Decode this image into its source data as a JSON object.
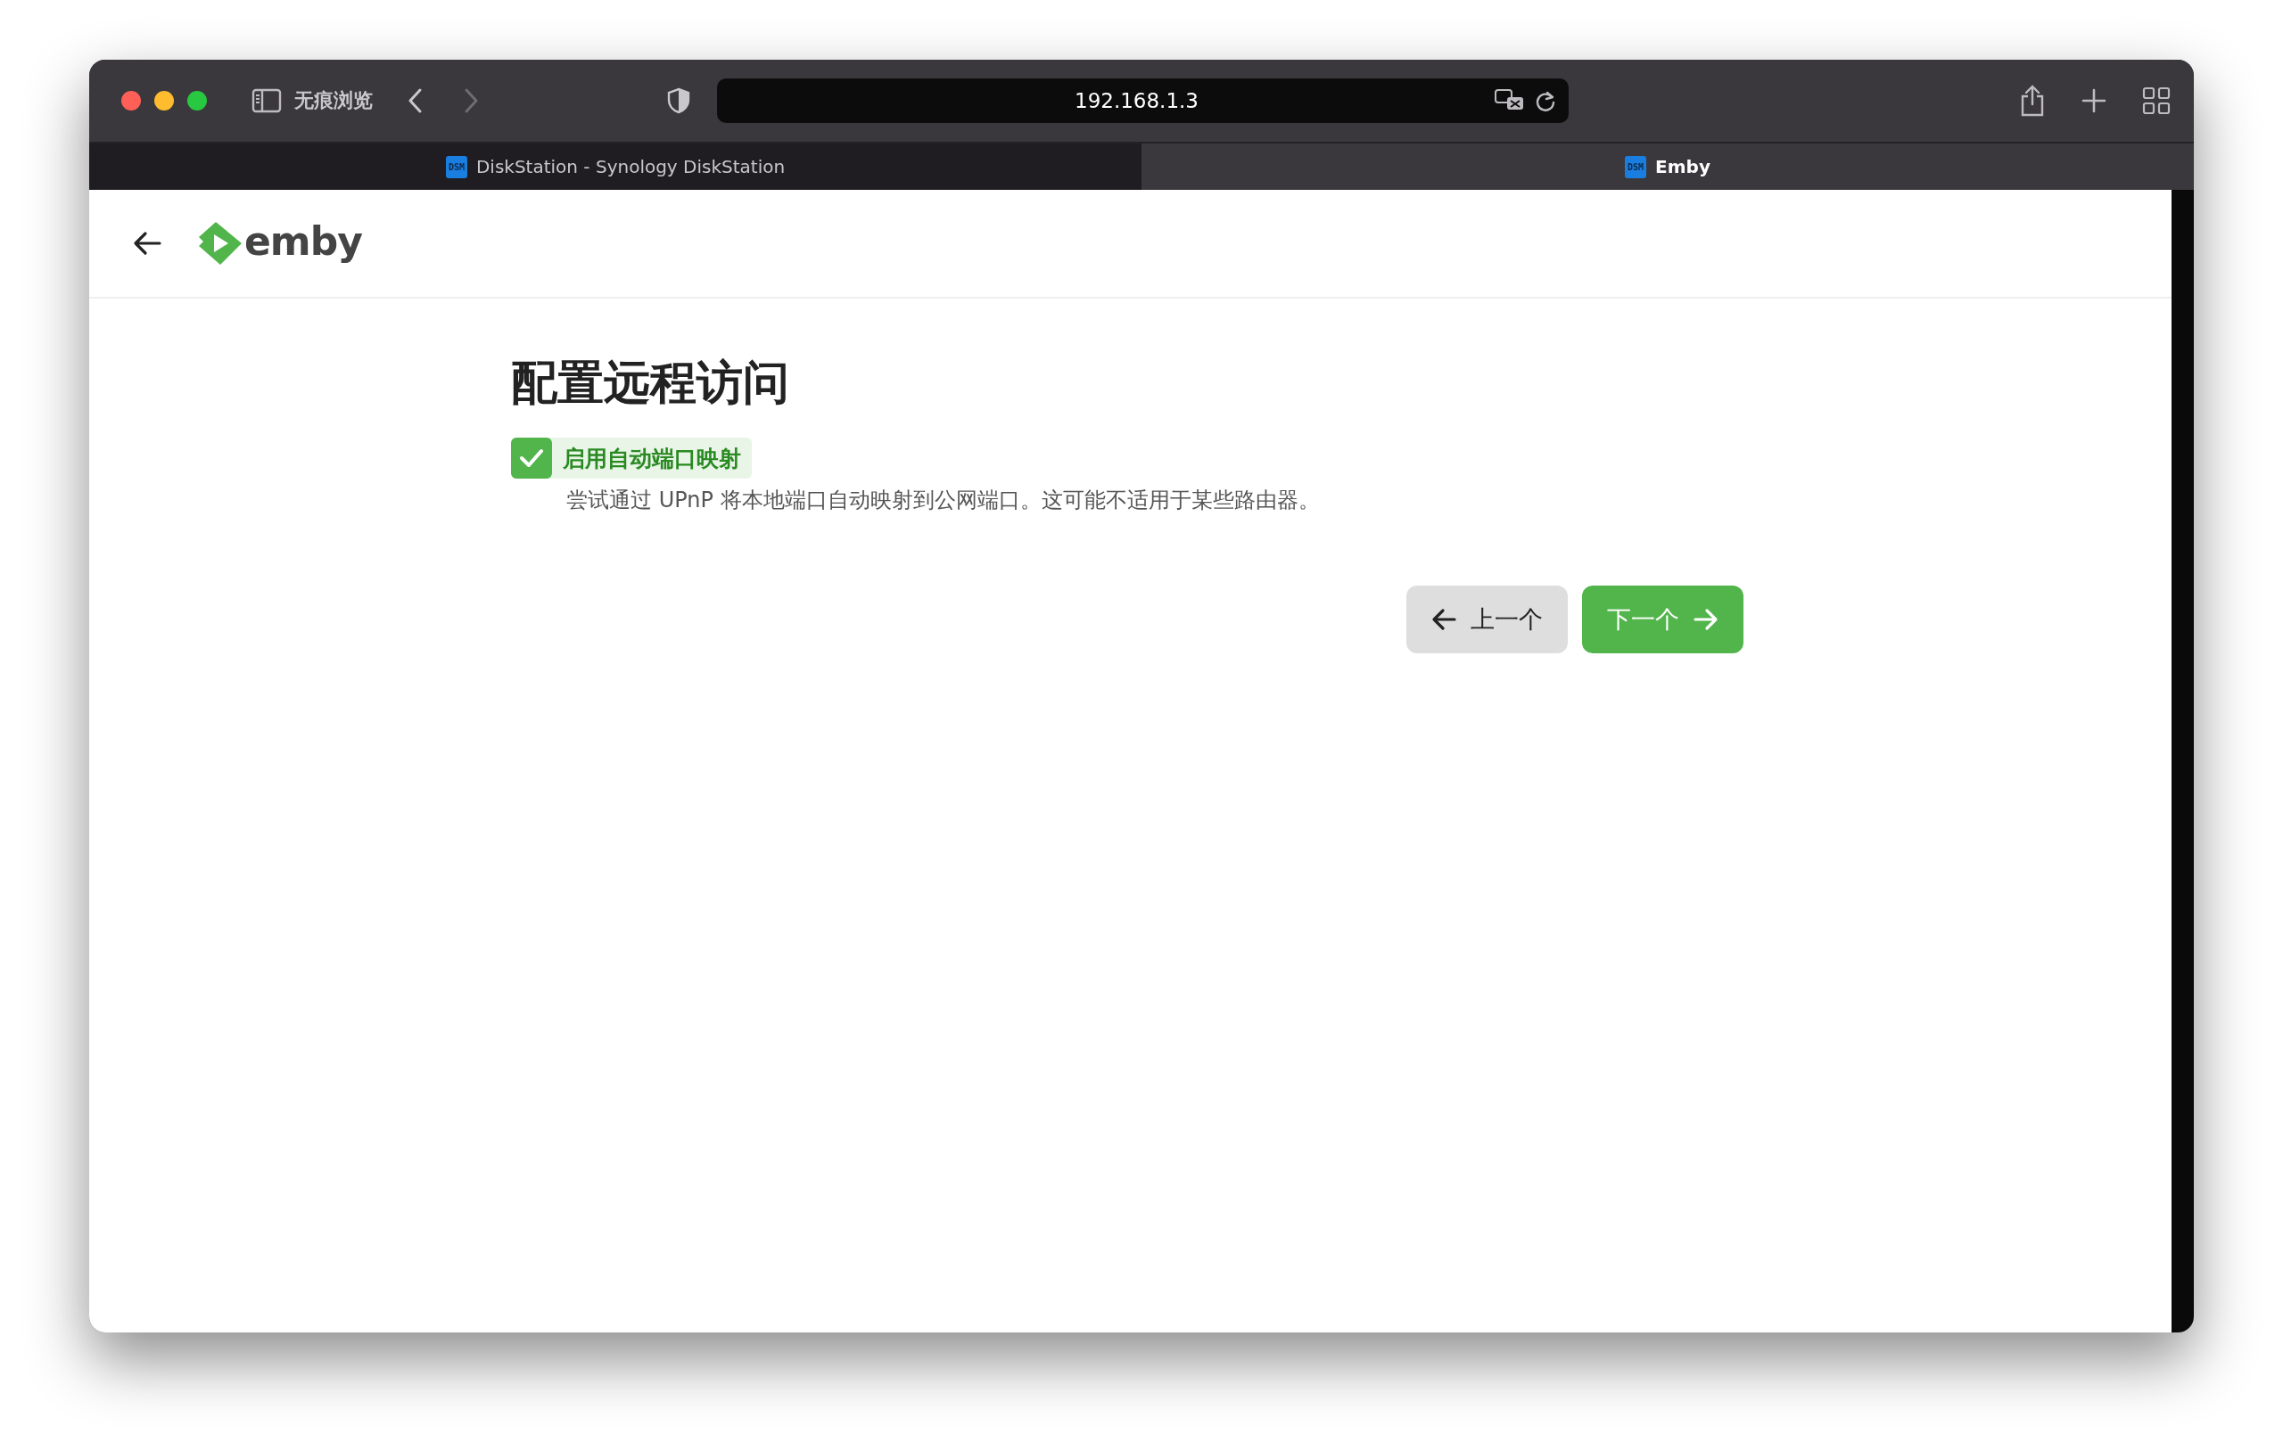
{
  "browser": {
    "sidebar_label": "无痕浏览",
    "url": "192.168.1.3",
    "tabs": [
      {
        "title": "DiskStation - Synology DiskStation",
        "favicon_text": "DSM",
        "selected": false
      },
      {
        "title": "Emby",
        "favicon_text": "DSM",
        "selected": true
      }
    ]
  },
  "header": {
    "logo_text": "emby"
  },
  "page": {
    "title": "配置远程访问",
    "option": {
      "label": "启用自动端口映射",
      "checked": true,
      "description": "尝试通过 UPnP 将本地端口自动映射到公网端口。这可能不适用于某些路由器。"
    },
    "buttons": [
      {
        "kind": "back",
        "label": "上一个"
      },
      {
        "kind": "next",
        "label": "下一个"
      }
    ]
  }
}
